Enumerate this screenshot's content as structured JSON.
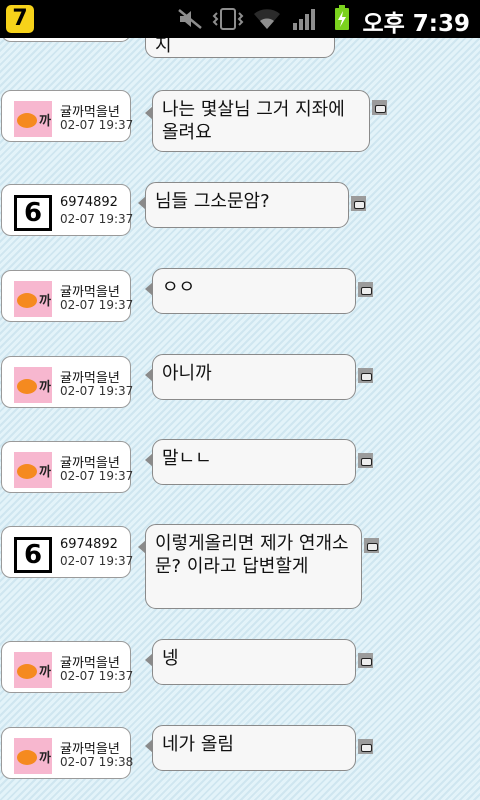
{
  "status_bar": {
    "app_icon_glyph": "7",
    "icons": [
      "notification-app-icon",
      "mute-icon",
      "vibrate-icon",
      "wifi-icon",
      "signal-icon",
      "battery-charging-icon"
    ],
    "time": "오후 7:39"
  },
  "partial_top_message": {
    "text": "지"
  },
  "messages": [
    {
      "nickname": "귤까먹을년",
      "timestamp": "02-07 19:37",
      "avatar": "tangerine",
      "text": "나는 몇살님 그거 지좌에 올려요"
    },
    {
      "nickname": "6974892",
      "timestamp": "02-07 19:37",
      "avatar": "six",
      "text": "님들 그소문암?"
    },
    {
      "nickname": "귤까먹을년",
      "timestamp": "02-07 19:37",
      "avatar": "tangerine",
      "text": "ㅇㅇ"
    },
    {
      "nickname": "귤까먹을년",
      "timestamp": "02-07 19:37",
      "avatar": "tangerine",
      "text": "아니까"
    },
    {
      "nickname": "귤까먹을년",
      "timestamp": "02-07 19:37",
      "avatar": "tangerine",
      "text": "말ㄴㄴ"
    },
    {
      "nickname": "6974892",
      "timestamp": "02-07 19:37",
      "avatar": "six",
      "text": "이렇게올리면 제가 연개소문? 이라고 답변할게"
    },
    {
      "nickname": "귤까먹을년",
      "timestamp": "02-07 19:37",
      "avatar": "tangerine",
      "text": "넹"
    },
    {
      "nickname": "귤까먹을년",
      "timestamp": "02-07 19:38",
      "avatar": "tangerine",
      "text": "네가 올림"
    }
  ],
  "avatar_glyphs": {
    "tangerine": "까",
    "six": "6"
  },
  "colors": {
    "status_bar": "#000000",
    "app_icon": "#f6d21a",
    "battery": "#7bd21e",
    "background": "#d6ecf4",
    "bubble": "#f7f7f7",
    "avatar_pink": "#f7b7cf",
    "avatar_orange": "#f58a1f"
  }
}
